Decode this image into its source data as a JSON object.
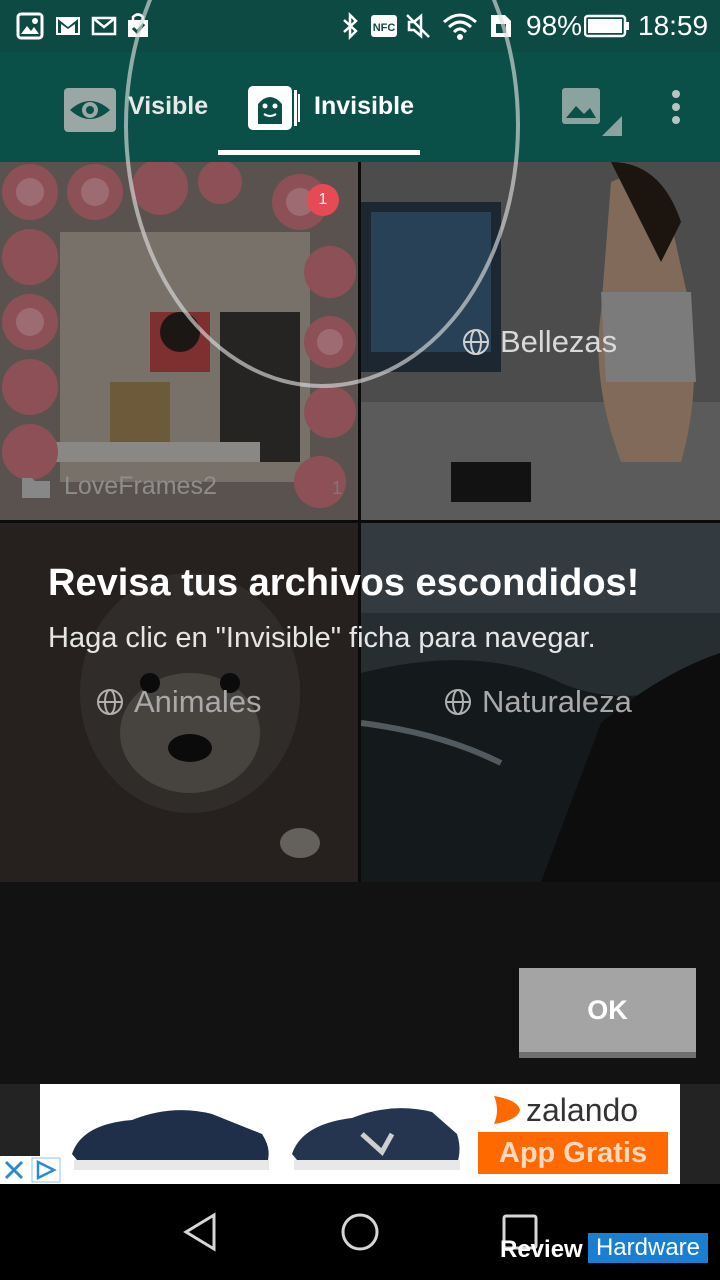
{
  "status_bar": {
    "battery": "98%",
    "time": "18:59"
  },
  "tabs": [
    {
      "label": "Visible"
    },
    {
      "label": "Invisible",
      "selected": true
    }
  ],
  "grid": {
    "albums": [
      {
        "name": "LoveFrames2",
        "count": "1",
        "icon": "folder-icon"
      },
      {
        "name": "Bellezas",
        "icon": "globe-icon"
      },
      {
        "name": "Animales",
        "icon": "globe-icon"
      },
      {
        "name": "Naturaleza",
        "icon": "globe-icon"
      }
    ],
    "spotlight_badge": "1"
  },
  "coach": {
    "title": "Revisa tus archivos escondidos!",
    "subtitle": "Haga clic en \"Invisible\" ficha para navegar.",
    "ok_label": "OK"
  },
  "ad": {
    "brand": "zalando",
    "cta": "App Gratis"
  },
  "watermark": {
    "part1": "Review",
    "part2": "Hardware"
  },
  "colors": {
    "app_bar": "#0b5048",
    "status_bar": "#0d4a43",
    "zalando_orange": "#ff6900"
  }
}
